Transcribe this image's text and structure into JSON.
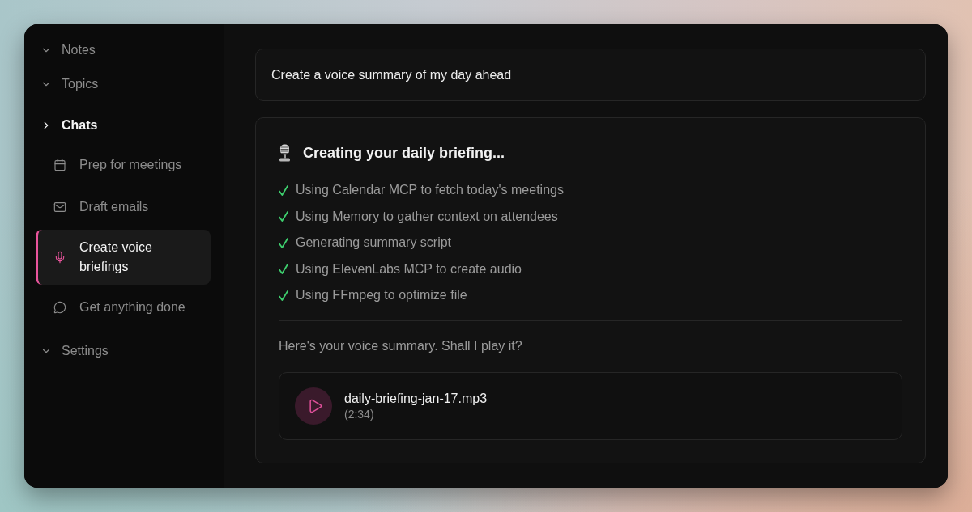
{
  "sidebar": {
    "sections": [
      {
        "label": "Notes",
        "expanded": false
      },
      {
        "label": "Topics",
        "expanded": false
      },
      {
        "label": "Chats",
        "expanded": true,
        "children": [
          {
            "label": "Prep for meetings",
            "selected": false
          },
          {
            "label": "Draft emails",
            "selected": false
          },
          {
            "label": "Create voice briefings",
            "selected": true
          },
          {
            "label": "Get anything done",
            "selected": false
          }
        ]
      },
      {
        "label": "Settings",
        "expanded": false
      }
    ]
  },
  "prompt": {
    "text": "Create a voice summary of my day ahead"
  },
  "response": {
    "title": "Creating your daily briefing...",
    "steps": [
      {
        "text": "Using Calendar MCP to fetch today's meetings",
        "done": true
      },
      {
        "text": "Using Memory to gather context on attendees",
        "done": true
      },
      {
        "text": "Generating summary script",
        "done": true
      },
      {
        "text": "Using ElevenLabs MCP to create audio",
        "done": true
      },
      {
        "text": "Using FFmpeg to optimize file",
        "done": true
      }
    ],
    "message": "Here's your voice summary. Shall I play it?",
    "audio": {
      "filename": "daily-briefing-jan-17.mp3",
      "duration": "(2:34)"
    }
  }
}
